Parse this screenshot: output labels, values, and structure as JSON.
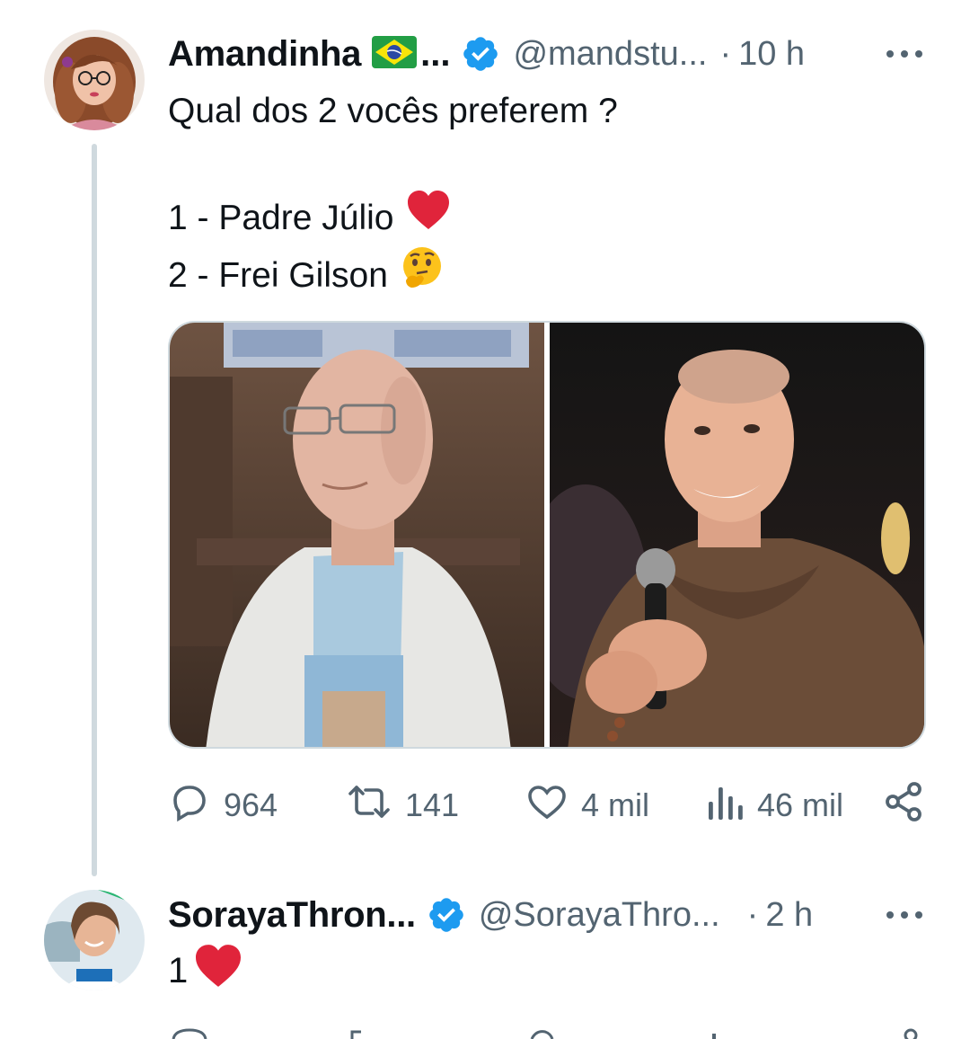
{
  "tweet": {
    "display_name": "Amandinha",
    "name_ellipsis": "...",
    "handle": "@mandstu...",
    "dot": "·",
    "time": "10 h",
    "text_line1": "Qual dos 2 vocês preferem ?",
    "option1": "1 - Padre Júlio",
    "option2": "2 - Frei Gilson",
    "option1_emoji": "red-heart",
    "option2_emoji": "thinking-face",
    "flag_icon": "brazil-flag",
    "stats": {
      "replies": "964",
      "retweets": "141",
      "likes": "4 mil",
      "views": "46 mil"
    }
  },
  "reply": {
    "display_name": "SorayaThron...",
    "handle": "@SorayaThro...",
    "dot": "·",
    "time": "2 h",
    "text": "1",
    "emoji": "red-heart"
  },
  "colors": {
    "text": "#0f1419",
    "secondary": "#536471",
    "verified": "#1d9bf0",
    "thread_line": "#cfd9de",
    "heart": "#e0243b"
  }
}
